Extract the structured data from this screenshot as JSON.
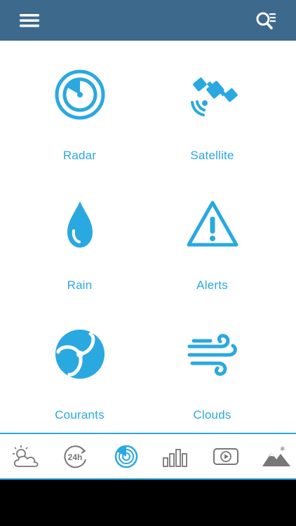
{
  "header": {
    "menu_icon": "hamburger-menu-icon",
    "search_icon": "search-list-icon"
  },
  "grid": {
    "items": [
      {
        "label": "Radar",
        "icon": "radar-icon"
      },
      {
        "label": "Satellite",
        "icon": "satellite-icon"
      },
      {
        "label": "Rain",
        "icon": "raindrop-icon"
      },
      {
        "label": "Alerts",
        "icon": "warning-triangle-icon"
      },
      {
        "label": "Courants",
        "icon": "currents-icon"
      },
      {
        "label": "Clouds",
        "icon": "wind-icon"
      }
    ]
  },
  "tabbar": {
    "tabs": [
      {
        "icon": "sun-cloud-icon",
        "active": false
      },
      {
        "icon": "24h-forecast-icon",
        "text": "24h",
        "active": false
      },
      {
        "icon": "radar-tab-icon",
        "active": true
      },
      {
        "icon": "bar-chart-icon",
        "active": false
      },
      {
        "icon": "video-play-icon",
        "active": false
      },
      {
        "icon": "mountain-snow-icon",
        "active": false
      }
    ]
  },
  "colors": {
    "header": "#3d6a8c",
    "accent": "#2aa8e0",
    "tab_inactive": "#777777"
  }
}
